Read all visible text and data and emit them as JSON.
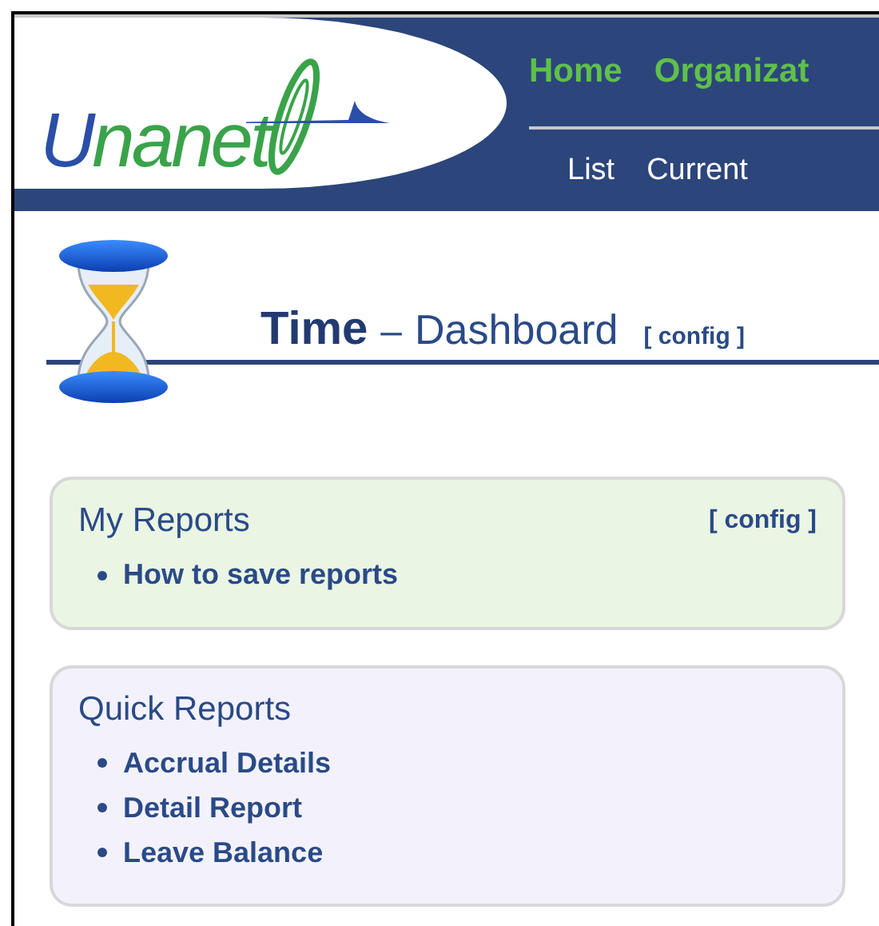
{
  "logo": {
    "text": "Unanet"
  },
  "nav": {
    "primary": [
      {
        "label": "Home"
      },
      {
        "label": "Organizat"
      }
    ],
    "secondary": [
      {
        "label": "List"
      },
      {
        "label": "Current"
      }
    ]
  },
  "page_title": {
    "module": "Time",
    "separator": "–",
    "page": "Dashboard",
    "config": "[ config ]"
  },
  "panels": [
    {
      "kind": "my",
      "title": "My Reports",
      "config": "[ config ]",
      "items": [
        "How to save reports"
      ]
    },
    {
      "kind": "quick",
      "title": "Quick Reports",
      "items": [
        "Accrual Details",
        "Detail Report",
        "Leave Balance"
      ]
    }
  ]
}
